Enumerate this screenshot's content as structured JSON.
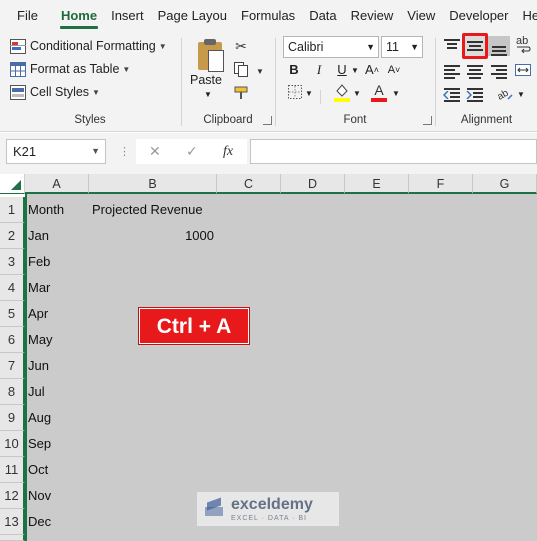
{
  "tabs": [
    "File",
    "Home",
    "Insert",
    "Page Layou",
    "Formulas",
    "Data",
    "Review",
    "View",
    "Developer",
    "Help"
  ],
  "active_tab": "Home",
  "ribbon": {
    "styles": {
      "conditional_formatting": "Conditional Formatting",
      "format_as_table": "Format as Table",
      "cell_styles": "Cell Styles",
      "label": "Styles"
    },
    "clipboard": {
      "paste": "Paste",
      "label": "Clipboard"
    },
    "font": {
      "name": "Calibri",
      "size": "11",
      "bold": "B",
      "italic": "I",
      "underline": "U",
      "grow": "A",
      "shrink": "A",
      "font_color": "A",
      "label": "Font"
    },
    "alignment": {
      "label": "Alignment",
      "wrap": "ab"
    }
  },
  "formula_bar": {
    "name_box": "K21",
    "cancel": "✕",
    "enter": "✓",
    "fx": "fx",
    "value": ""
  },
  "columns": [
    "A",
    "B",
    "C",
    "D",
    "E",
    "F",
    "G"
  ],
  "rows": [
    "1",
    "2",
    "3",
    "4",
    "5",
    "6",
    "7",
    "8",
    "9",
    "10",
    "11",
    "12",
    "13"
  ],
  "cells": {
    "A1": "Month",
    "B1": "Projected Revenue",
    "A2": "Jan",
    "B2": "1000",
    "A3": "Feb",
    "A4": "Mar",
    "A5": "Apr",
    "A6": "May",
    "A7": "Jun",
    "A8": "Jul",
    "A9": "Aug",
    "A10": "Sep",
    "A11": "Oct",
    "A12": "Nov",
    "A13": "Dec"
  },
  "overlay_badge": "Ctrl + A",
  "watermark": {
    "name": "exceldemy",
    "tagline": "EXCEL · DATA · BI"
  },
  "colors": {
    "excel_green": "#1e7145",
    "highlight_red": "#e8191b",
    "selection_gray": "#cbcbcb"
  }
}
